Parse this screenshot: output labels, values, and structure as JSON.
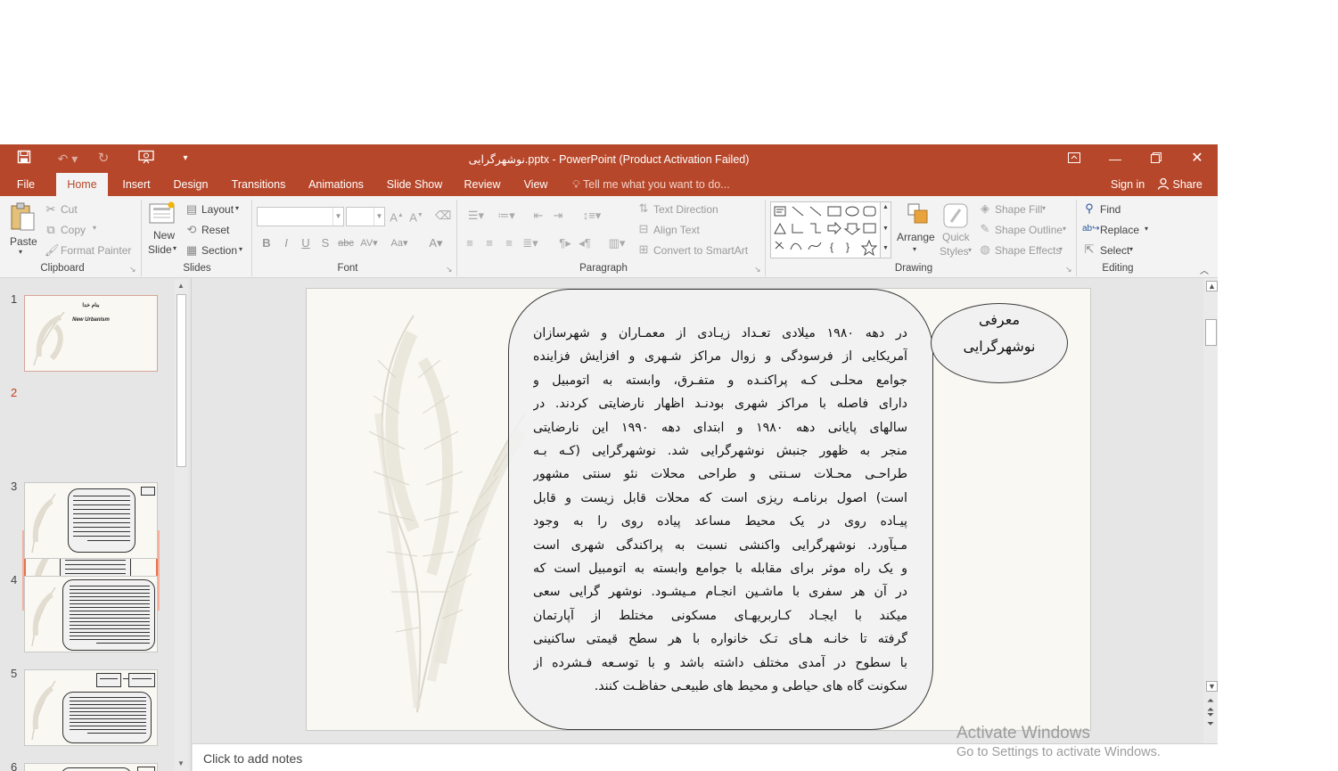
{
  "window": {
    "title": "نوشهرگرایی.pptx - PowerPoint (Product Activation Failed)",
    "accent": "#b7472a",
    "qat_icons": [
      "save-icon",
      "undo-icon",
      "redo-icon",
      "slideshow-from-start-icon",
      "customize-qat-icon"
    ]
  },
  "tabs": [
    "File",
    "Home",
    "Insert",
    "Design",
    "Transitions",
    "Animations",
    "Slide Show",
    "Review",
    "View"
  ],
  "active_tab": "Home",
  "tell_me": "Tell me what you want to do...",
  "sign_in": "Sign in",
  "share": "Share",
  "ribbon": {
    "clipboard": {
      "label": "Clipboard",
      "paste": "Paste",
      "cut": "Cut",
      "copy": "Copy",
      "format_painter": "Format Painter"
    },
    "slides": {
      "label": "Slides",
      "new_slide_1": "New",
      "new_slide_2": "Slide",
      "layout": "Layout",
      "reset": "Reset",
      "section": "Section"
    },
    "font": {
      "label": "Font"
    },
    "paragraph": {
      "label": "Paragraph",
      "text_direction": "Text Direction",
      "align_text": "Align Text",
      "convert_smartart": "Convert to SmartArt"
    },
    "drawing": {
      "label": "Drawing",
      "arrange": "Arrange",
      "quick_styles_1": "Quick",
      "quick_styles_2": "Styles",
      "shape_fill": "Shape Fill",
      "shape_outline": "Shape Outline",
      "shape_effects": "Shape Effects"
    },
    "editing": {
      "label": "Editing",
      "find": "Find",
      "replace": "Replace",
      "select": "Select"
    }
  },
  "thumbnails": [
    {
      "num": "1",
      "title": "بنام خدا",
      "subtitle": "New Urbanism"
    },
    {
      "num": "2"
    },
    {
      "num": "3"
    },
    {
      "num": "4"
    },
    {
      "num": "5"
    }
  ],
  "selected_slide": "2",
  "slide": {
    "heading_line1": "معرفی",
    "heading_line2": "نوشهرگرایی",
    "body_lines": [
      "در دهه ۱۹۸۰ میلادی تعـداد زیـادی از معمـاران و شهرسازان",
      "آمریکایی از فرسودگی و زوال مراکز شـهری و افزایش فزاینده",
      "جوامع محلـی کـه پراکنـده و متفـرق، وابسته به اتومبیل و",
      "دارای فاصله با مراکز شهری بودنـد اظهار نارضایتی کردند. در",
      "سالهای پایانی دهه ۱۹۸۰ و ابتدای دهه ۱۹۹۰ این نارضایتی",
      "منجر به ظهور جنبش نوشهرگرایی شد. نوشهرگرایی (کـه بـه",
      "طراحـی محـلات سـنتی و طراحی محلات نئو سنتی مشهور",
      "است) اصول برنامـه ریزی است که محلات قابل زیست و قابل",
      "پیـاده روی  در یک محیط مساعد پیاده روی را به وجود",
      "مـیآورد. نوشهرگرایی واکنشی نسبت به پراکندگی شهری است",
      "و یک راه موثر برای مقابله با جوامع وابسته به اتومبیل است که",
      "در آن هر سفری با ماشـین انجـام مـیشـود. نوشهر گرایی سعی",
      "میکند با  ایجـاد  کـاربریهـای مسکونی مختلط از آپارتمان",
      "گرفته تا خانـه هـای تـک خانواره با هر سطح قیمتی ساکنینی",
      "با سطوح در آمدی مختلف داشته باشد و با توسـعه فـشرده از",
      "سکونت گاه های حیاطی و محیط های طبیعـی حفاظـت کنند."
    ]
  },
  "notes_placeholder": "Click to add notes",
  "watermark": {
    "line1": "Activate Windows",
    "line2": "Go to Settings to activate Windows."
  }
}
